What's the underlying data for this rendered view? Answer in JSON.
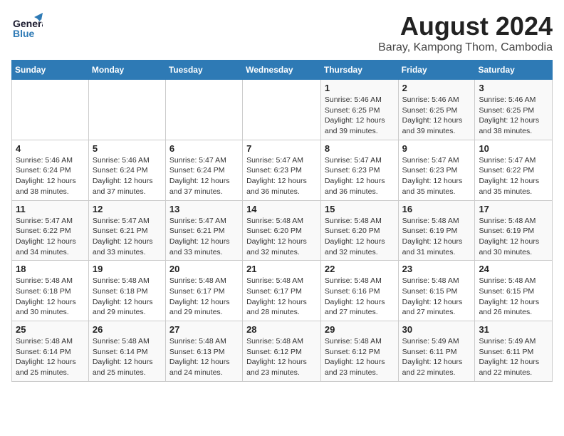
{
  "header": {
    "logo_general": "General",
    "logo_blue": "Blue",
    "month_year": "August 2024",
    "location": "Baray, Kampong Thom, Cambodia"
  },
  "weekdays": [
    "Sunday",
    "Monday",
    "Tuesday",
    "Wednesday",
    "Thursday",
    "Friday",
    "Saturday"
  ],
  "weeks": [
    [
      {
        "num": "",
        "detail": ""
      },
      {
        "num": "",
        "detail": ""
      },
      {
        "num": "",
        "detail": ""
      },
      {
        "num": "",
        "detail": ""
      },
      {
        "num": "1",
        "detail": "Sunrise: 5:46 AM\nSunset: 6:25 PM\nDaylight: 12 hours\nand 39 minutes."
      },
      {
        "num": "2",
        "detail": "Sunrise: 5:46 AM\nSunset: 6:25 PM\nDaylight: 12 hours\nand 39 minutes."
      },
      {
        "num": "3",
        "detail": "Sunrise: 5:46 AM\nSunset: 6:25 PM\nDaylight: 12 hours\nand 38 minutes."
      }
    ],
    [
      {
        "num": "4",
        "detail": "Sunrise: 5:46 AM\nSunset: 6:24 PM\nDaylight: 12 hours\nand 38 minutes."
      },
      {
        "num": "5",
        "detail": "Sunrise: 5:46 AM\nSunset: 6:24 PM\nDaylight: 12 hours\nand 37 minutes."
      },
      {
        "num": "6",
        "detail": "Sunrise: 5:47 AM\nSunset: 6:24 PM\nDaylight: 12 hours\nand 37 minutes."
      },
      {
        "num": "7",
        "detail": "Sunrise: 5:47 AM\nSunset: 6:23 PM\nDaylight: 12 hours\nand 36 minutes."
      },
      {
        "num": "8",
        "detail": "Sunrise: 5:47 AM\nSunset: 6:23 PM\nDaylight: 12 hours\nand 36 minutes."
      },
      {
        "num": "9",
        "detail": "Sunrise: 5:47 AM\nSunset: 6:23 PM\nDaylight: 12 hours\nand 35 minutes."
      },
      {
        "num": "10",
        "detail": "Sunrise: 5:47 AM\nSunset: 6:22 PM\nDaylight: 12 hours\nand 35 minutes."
      }
    ],
    [
      {
        "num": "11",
        "detail": "Sunrise: 5:47 AM\nSunset: 6:22 PM\nDaylight: 12 hours\nand 34 minutes."
      },
      {
        "num": "12",
        "detail": "Sunrise: 5:47 AM\nSunset: 6:21 PM\nDaylight: 12 hours\nand 33 minutes."
      },
      {
        "num": "13",
        "detail": "Sunrise: 5:47 AM\nSunset: 6:21 PM\nDaylight: 12 hours\nand 33 minutes."
      },
      {
        "num": "14",
        "detail": "Sunrise: 5:48 AM\nSunset: 6:20 PM\nDaylight: 12 hours\nand 32 minutes."
      },
      {
        "num": "15",
        "detail": "Sunrise: 5:48 AM\nSunset: 6:20 PM\nDaylight: 12 hours\nand 32 minutes."
      },
      {
        "num": "16",
        "detail": "Sunrise: 5:48 AM\nSunset: 6:19 PM\nDaylight: 12 hours\nand 31 minutes."
      },
      {
        "num": "17",
        "detail": "Sunrise: 5:48 AM\nSunset: 6:19 PM\nDaylight: 12 hours\nand 30 minutes."
      }
    ],
    [
      {
        "num": "18",
        "detail": "Sunrise: 5:48 AM\nSunset: 6:18 PM\nDaylight: 12 hours\nand 30 minutes."
      },
      {
        "num": "19",
        "detail": "Sunrise: 5:48 AM\nSunset: 6:18 PM\nDaylight: 12 hours\nand 29 minutes."
      },
      {
        "num": "20",
        "detail": "Sunrise: 5:48 AM\nSunset: 6:17 PM\nDaylight: 12 hours\nand 29 minutes."
      },
      {
        "num": "21",
        "detail": "Sunrise: 5:48 AM\nSunset: 6:17 PM\nDaylight: 12 hours\nand 28 minutes."
      },
      {
        "num": "22",
        "detail": "Sunrise: 5:48 AM\nSunset: 6:16 PM\nDaylight: 12 hours\nand 27 minutes."
      },
      {
        "num": "23",
        "detail": "Sunrise: 5:48 AM\nSunset: 6:15 PM\nDaylight: 12 hours\nand 27 minutes."
      },
      {
        "num": "24",
        "detail": "Sunrise: 5:48 AM\nSunset: 6:15 PM\nDaylight: 12 hours\nand 26 minutes."
      }
    ],
    [
      {
        "num": "25",
        "detail": "Sunrise: 5:48 AM\nSunset: 6:14 PM\nDaylight: 12 hours\nand 25 minutes."
      },
      {
        "num": "26",
        "detail": "Sunrise: 5:48 AM\nSunset: 6:14 PM\nDaylight: 12 hours\nand 25 minutes."
      },
      {
        "num": "27",
        "detail": "Sunrise: 5:48 AM\nSunset: 6:13 PM\nDaylight: 12 hours\nand 24 minutes."
      },
      {
        "num": "28",
        "detail": "Sunrise: 5:48 AM\nSunset: 6:12 PM\nDaylight: 12 hours\nand 23 minutes."
      },
      {
        "num": "29",
        "detail": "Sunrise: 5:48 AM\nSunset: 6:12 PM\nDaylight: 12 hours\nand 23 minutes."
      },
      {
        "num": "30",
        "detail": "Sunrise: 5:49 AM\nSunset: 6:11 PM\nDaylight: 12 hours\nand 22 minutes."
      },
      {
        "num": "31",
        "detail": "Sunrise: 5:49 AM\nSunset: 6:11 PM\nDaylight: 12 hours\nand 22 minutes."
      }
    ]
  ]
}
